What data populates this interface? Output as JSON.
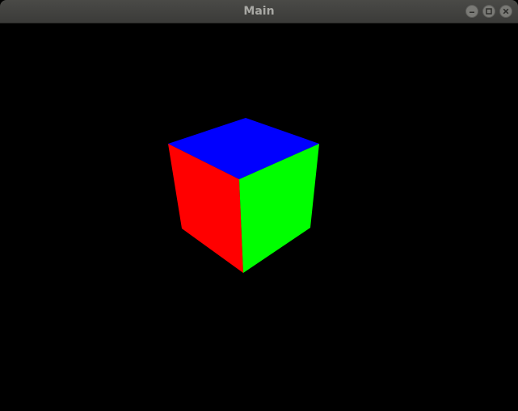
{
  "window": {
    "title": "Main",
    "controls": [
      {
        "icon": "minimize-icon"
      },
      {
        "icon": "maximize-icon"
      },
      {
        "icon": "close-icon"
      }
    ]
  },
  "scene": {
    "background": "#000000",
    "cube_faces": {
      "top": "#0000ff",
      "left": "#ff0000",
      "right": "#00ff00"
    }
  }
}
